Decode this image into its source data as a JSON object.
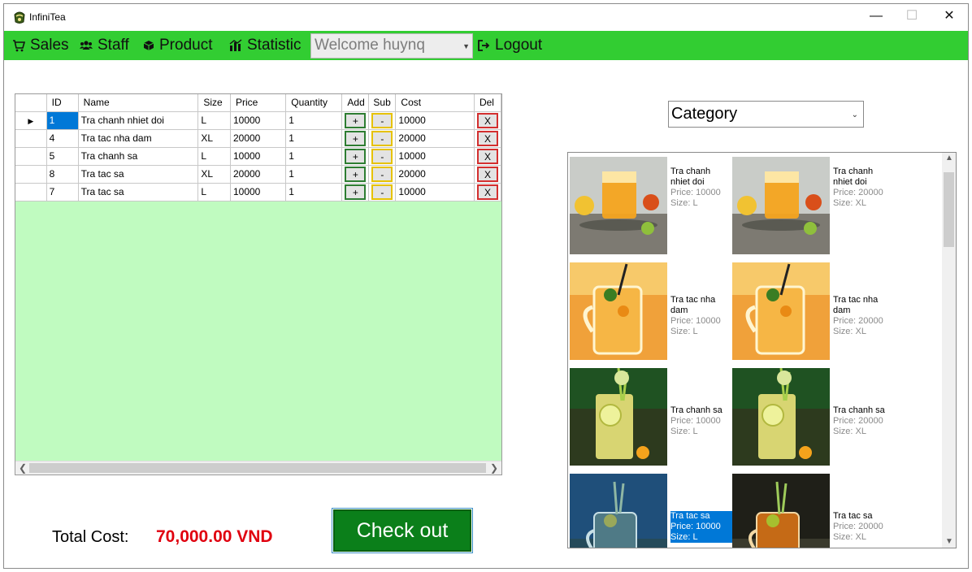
{
  "window": {
    "title": "InfiniTea",
    "minimize_glyph": "—",
    "maximize_glyph": "☐",
    "close_glyph": "✕"
  },
  "menu": {
    "items": [
      {
        "label": "Sales",
        "icon": "cart-icon"
      },
      {
        "label": "Staff",
        "icon": "users-icon"
      },
      {
        "label": "Product",
        "icon": "box-icon"
      },
      {
        "label": "Statistic",
        "icon": "chart-icon"
      }
    ],
    "welcome": "Welcome huynq",
    "logout": "Logout"
  },
  "grid": {
    "columns": [
      "ID",
      "Name",
      "Size",
      "Price",
      "Quantity",
      "Add",
      "Sub",
      "Cost",
      "Del"
    ],
    "rows": [
      {
        "id": "1",
        "name": "Tra chanh nhiet doi",
        "size": "L",
        "price": "10000",
        "qty": "1",
        "cost": "10000"
      },
      {
        "id": "4",
        "name": "Tra tac nha dam",
        "size": "XL",
        "price": "20000",
        "qty": "1",
        "cost": "20000"
      },
      {
        "id": "5",
        "name": "Tra chanh sa",
        "size": "L",
        "price": "10000",
        "qty": "1",
        "cost": "10000"
      },
      {
        "id": "8",
        "name": "Tra tac sa",
        "size": "XL",
        "price": "20000",
        "qty": "1",
        "cost": "20000"
      },
      {
        "id": "7",
        "name": "Tra tac sa",
        "size": "L",
        "price": "10000",
        "qty": "1",
        "cost": "10000"
      }
    ],
    "add_label": "+",
    "sub_label": "-",
    "del_label": "X",
    "current_row_glyph": "▶"
  },
  "total": {
    "label": "Total Cost:",
    "value": "70,000.00 VND"
  },
  "checkout_label": "Check out",
  "category": {
    "selected": "Category"
  },
  "products": [
    {
      "name": "Tra chanh nhiet doi",
      "price": "Price: 10000",
      "size": "Size: L",
      "kind": "orange-tea",
      "selected": false
    },
    {
      "name": "Tra chanh nhiet doi",
      "price": "Price: 20000",
      "size": "Size: XL",
      "kind": "orange-tea",
      "selected": false
    },
    {
      "name": "Tra tac nha dam",
      "price": "Price: 10000",
      "size": "Size: L",
      "kind": "kumquat-jar",
      "selected": false
    },
    {
      "name": "Tra tac nha dam",
      "price": "Price: 20000",
      "size": "Size: XL",
      "kind": "kumquat-jar",
      "selected": false
    },
    {
      "name": "Tra chanh sa",
      "price": "Price: 10000",
      "size": "Size: L",
      "kind": "lemongrass",
      "selected": false
    },
    {
      "name": "Tra chanh sa",
      "price": "Price: 20000",
      "size": "Size: XL",
      "kind": "lemongrass",
      "selected": false
    },
    {
      "name": "Tra tac sa",
      "price": "Price: 10000",
      "size": "Size: L",
      "kind": "kumquat-blue",
      "selected": true
    },
    {
      "name": "Tra tac sa",
      "price": "Price: 20000",
      "size": "Size: XL",
      "kind": "kumquat-dark",
      "selected": false
    }
  ],
  "colors": {
    "menu_bar": "#32cd32",
    "grid_background": "#c0fbc0",
    "total_value": "#e0000f",
    "checkout": "#0b7f1a",
    "selection": "#0078d7"
  }
}
